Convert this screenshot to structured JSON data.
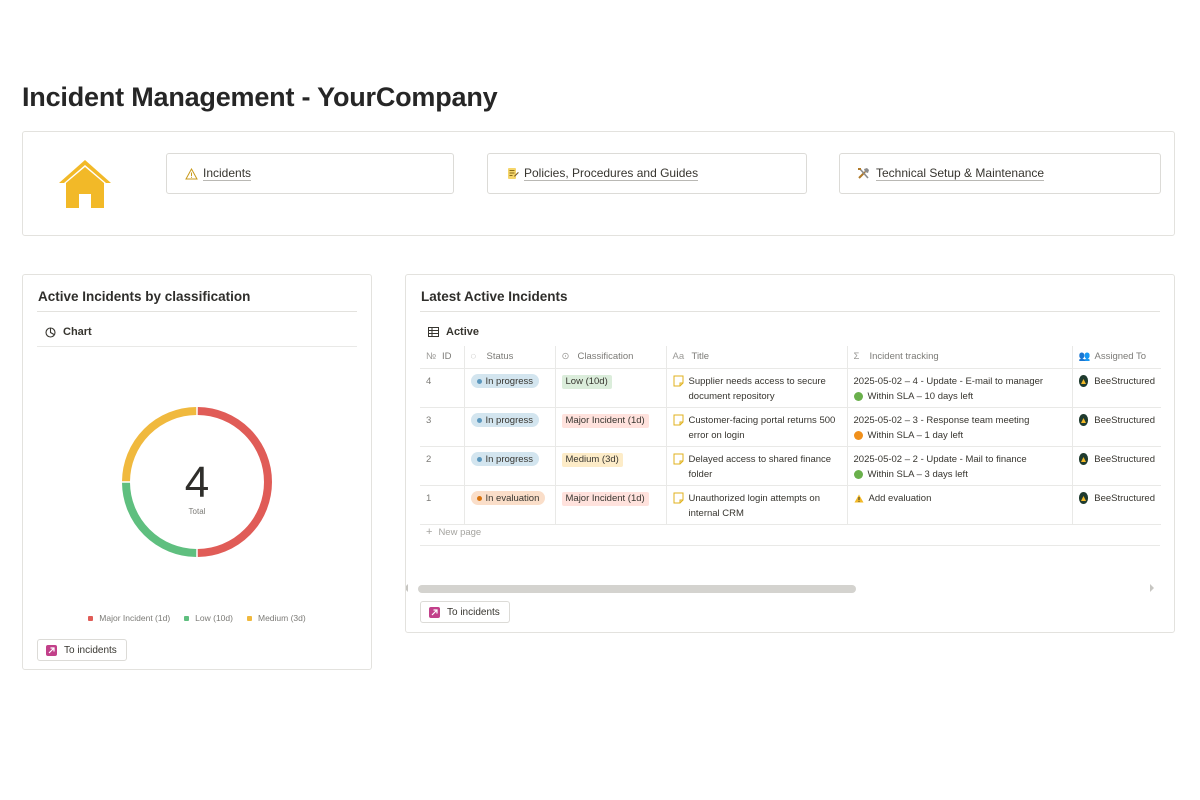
{
  "page": {
    "title": "Incident Management - YourCompany"
  },
  "nav": {
    "buttons": [
      {
        "label": "Incidents",
        "icon": "warning-icon"
      },
      {
        "label": "Policies, Procedures and Guides",
        "icon": "notes-icon"
      },
      {
        "label": "Technical Setup & Maintenance",
        "icon": "tools-icon"
      }
    ],
    "home_icon": "house-icon",
    "home_color": "#f2b928"
  },
  "left_card": {
    "title": "Active Incidents by classification",
    "view_tab": "Chart",
    "link_label": "To incidents"
  },
  "chart_data": {
    "type": "pie",
    "variant": "donut",
    "center_value": "4",
    "center_label": "Total",
    "categories": [
      "Major Incident (1d)",
      "Low (10d)",
      "Medium (3d)"
    ],
    "values": [
      2,
      1,
      1
    ],
    "colors": [
      "#e05c57",
      "#5fbf7f",
      "#f0b93e"
    ],
    "legend_position": "bottom"
  },
  "right_card": {
    "title": "Latest Active Incidents",
    "view_tab": "Active",
    "columns": [
      "ID",
      "Status",
      "Classification",
      "Title",
      "Incident tracking",
      "Assigned To"
    ],
    "rows": [
      {
        "id": "4",
        "status": "In progress",
        "classification": "Low (10d)",
        "title": "Supplier needs access to secure document repository",
        "tracking": "2025-05-02 – 4 - Update - E-mail to manager",
        "sla": "Within SLA – 10 days left",
        "sla_color": "#6ab04c",
        "assignee": "BeeStructured"
      },
      {
        "id": "3",
        "status": "In progress",
        "classification": "Major Incident (1d)",
        "title": "Customer-facing portal returns 500 error on login",
        "tracking": "2025-05-02 – 3 - Response team meeting",
        "sla": "Within SLA – 1 day left",
        "sla_color": "#f0901c",
        "assignee": "BeeStructured"
      },
      {
        "id": "2",
        "status": "In progress",
        "classification": "Medium (3d)",
        "title": "Delayed access to shared finance folder",
        "tracking": "2025-05-02 – 2 - Update - Mail to finance",
        "sla": "Within SLA – 3 days left",
        "sla_color": "#6ab04c",
        "assignee": "BeeStructured"
      },
      {
        "id": "1",
        "status": "In evaluation",
        "classification": "Major Incident (1d)",
        "title": "Unauthorized login attempts on internal CRM",
        "tracking": "Add evaluation",
        "sla": "",
        "sla_color": "",
        "assignee": "BeeStructured"
      }
    ],
    "new_page_label": "New page",
    "link_label": "To incidents"
  },
  "colors": {
    "status_in_progress_bg": "#d3e5ef",
    "status_in_progress_dot": "#5b97bd",
    "status_in_evaluation_bg": "#fadec9",
    "status_in_evaluation_dot": "#d9730d",
    "class_low_bg": "#dbeddb",
    "class_major_bg": "#ffe2dd",
    "class_medium_bg": "#fdecc8"
  }
}
